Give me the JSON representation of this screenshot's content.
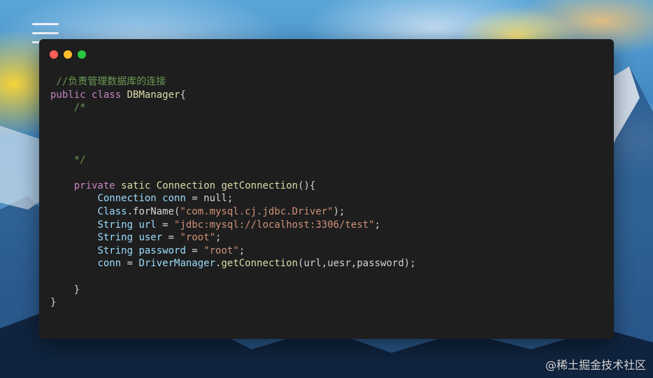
{
  "menu_icon": "hamburger-menu-icon",
  "window": {
    "controls": [
      {
        "name": "close",
        "color": "#ff5f56"
      },
      {
        "name": "minimize",
        "color": "#ffbd2e"
      },
      {
        "name": "maximize",
        "color": "#27c93f"
      }
    ]
  },
  "code": {
    "lines": [
      [
        {
          "t": " //负责管理数据库的连接",
          "c": "com"
        }
      ],
      [
        {
          "t": "public",
          "c": "kw"
        },
        {
          "t": " ",
          "c": "pun"
        },
        {
          "t": "class",
          "c": "kw"
        },
        {
          "t": " ",
          "c": "pun"
        },
        {
          "t": "DBManager",
          "c": "fn"
        },
        {
          "t": "{",
          "c": "pun"
        }
      ],
      [
        {
          "t": "    /*",
          "c": "com"
        }
      ],
      [],
      [],
      [],
      [
        {
          "t": "    */",
          "c": "com"
        }
      ],
      [],
      [
        {
          "t": "    ",
          "c": "pun"
        },
        {
          "t": "private",
          "c": "kw"
        },
        {
          "t": " ",
          "c": "pun"
        },
        {
          "t": "satic",
          "c": "fn"
        },
        {
          "t": " ",
          "c": "pun"
        },
        {
          "t": "Connection",
          "c": "fn"
        },
        {
          "t": " ",
          "c": "pun"
        },
        {
          "t": "getConnection",
          "c": "fn"
        },
        {
          "t": "(){",
          "c": "pun"
        }
      ],
      [
        {
          "t": "        ",
          "c": "pun"
        },
        {
          "t": "Connection",
          "c": "var"
        },
        {
          "t": " ",
          "c": "pun"
        },
        {
          "t": "conn",
          "c": "var"
        },
        {
          "t": " = null;",
          "c": "pun"
        }
      ],
      [
        {
          "t": "        ",
          "c": "pun"
        },
        {
          "t": "Class",
          "c": "var"
        },
        {
          "t": ".forName(",
          "c": "pun"
        },
        {
          "t": "\"com.mysql.cj.jdbc.Driver\"",
          "c": "str"
        },
        {
          "t": ");",
          "c": "pun"
        }
      ],
      [
        {
          "t": "        ",
          "c": "pun"
        },
        {
          "t": "String",
          "c": "var"
        },
        {
          "t": " ",
          "c": "pun"
        },
        {
          "t": "url",
          "c": "var"
        },
        {
          "t": " = ",
          "c": "pun"
        },
        {
          "t": "\"jdbc:mysql://localhost:3306/test\"",
          "c": "str"
        },
        {
          "t": ";",
          "c": "pun"
        }
      ],
      [
        {
          "t": "        ",
          "c": "pun"
        },
        {
          "t": "String",
          "c": "var"
        },
        {
          "t": " ",
          "c": "pun"
        },
        {
          "t": "user",
          "c": "var"
        },
        {
          "t": " = ",
          "c": "pun"
        },
        {
          "t": "\"root\"",
          "c": "str"
        },
        {
          "t": ";",
          "c": "pun"
        }
      ],
      [
        {
          "t": "        ",
          "c": "pun"
        },
        {
          "t": "String",
          "c": "var"
        },
        {
          "t": " ",
          "c": "pun"
        },
        {
          "t": "password",
          "c": "var"
        },
        {
          "t": " = ",
          "c": "pun"
        },
        {
          "t": "\"root\"",
          "c": "str"
        },
        {
          "t": ";",
          "c": "pun"
        }
      ],
      [
        {
          "t": "        ",
          "c": "pun"
        },
        {
          "t": "conn",
          "c": "var"
        },
        {
          "t": " = ",
          "c": "pun"
        },
        {
          "t": "DriverManager",
          "c": "var"
        },
        {
          "t": ".",
          "c": "pun"
        },
        {
          "t": "getConnection",
          "c": "fn"
        },
        {
          "t": "(url,uesr,password);",
          "c": "pun"
        }
      ],
      [],
      [
        {
          "t": "    }",
          "c": "pun"
        }
      ],
      [
        {
          "t": "}",
          "c": "pun"
        }
      ]
    ]
  },
  "watermark": "@稀土掘金技术社区"
}
